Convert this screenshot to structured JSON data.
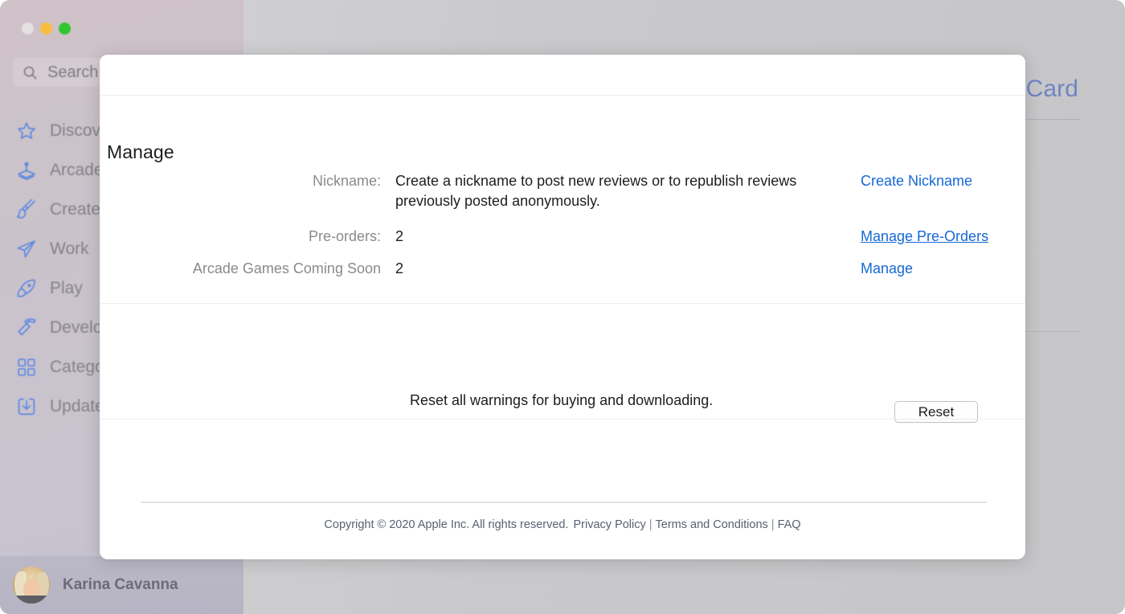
{
  "window": {
    "traffic_lights": [
      "close",
      "minimize",
      "maximize"
    ],
    "background_heading": "t Card"
  },
  "sidebar": {
    "search": {
      "placeholder": "Search",
      "icon": "search-icon"
    },
    "items": [
      {
        "label": "Discover",
        "icon": "star-icon"
      },
      {
        "label": "Arcade",
        "icon": "joystick-icon"
      },
      {
        "label": "Create",
        "icon": "paintbrush-icon"
      },
      {
        "label": "Work",
        "icon": "paper-plane-icon"
      },
      {
        "label": "Play",
        "icon": "rocket-icon"
      },
      {
        "label": "Develop",
        "icon": "hammer-icon"
      },
      {
        "label": "Categories",
        "icon": "grid-icon"
      },
      {
        "label": "Updates",
        "icon": "download-icon"
      }
    ],
    "user": {
      "name": "Karina Cavanna",
      "avatar": "user-avatar-photo"
    }
  },
  "modal": {
    "section_title": "Manage",
    "rows": [
      {
        "label": "Nickname:",
        "value": "Create a nickname to post new reviews or to republish reviews previously posted anonymously.",
        "action": "Create Nickname",
        "action_hovered": false
      },
      {
        "label": "Pre-orders:",
        "value": "2",
        "action": "Manage Pre-Orders",
        "action_hovered": true
      },
      {
        "label": "Arcade Games Coming Soon",
        "value": "2",
        "action": "Manage",
        "action_hovered": false
      }
    ],
    "reset": {
      "text": "Reset all warnings for buying and downloading.",
      "button_label": "Reset"
    },
    "footer": {
      "copyright": "Copyright © 2020 Apple Inc. All rights reserved.",
      "links": [
        "Privacy Policy",
        "Terms and Conditions",
        "FAQ"
      ],
      "separator": "|"
    }
  },
  "colors": {
    "link": "#1668d6",
    "label_gray": "#8a8a8e",
    "text": "#1d1d1f",
    "footer_text": "#5a6073",
    "sidebar_icon": "#5d8ae0"
  }
}
